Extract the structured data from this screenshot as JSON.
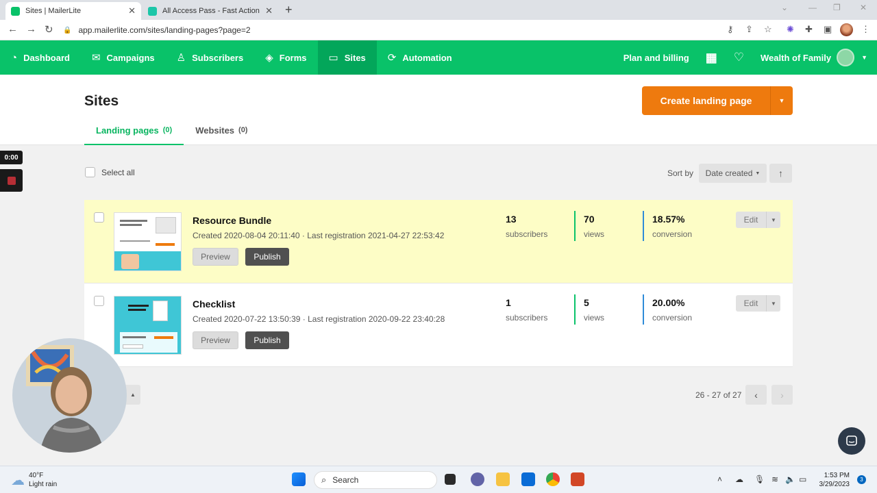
{
  "browser": {
    "tabs": [
      {
        "title": "Sites | MailerLite",
        "favicon_color": "#09c269"
      },
      {
        "title": "All Access Pass - Fast Action » Po",
        "favicon_color": "#1cc6a8"
      }
    ],
    "url": "app.mailerlite.com/sites/landing-pages?page=2"
  },
  "appnav": {
    "items": [
      {
        "label": "Dashboard",
        "icon": "dashboard-icon"
      },
      {
        "label": "Campaigns",
        "icon": "envelope-icon"
      },
      {
        "label": "Subscribers",
        "icon": "person-icon"
      },
      {
        "label": "Forms",
        "icon": "layers-icon"
      },
      {
        "label": "Sites",
        "icon": "browser-icon"
      },
      {
        "label": "Automation",
        "icon": "refresh-icon"
      }
    ],
    "plan_billing": "Plan and billing",
    "account_name": "Wealth of Family"
  },
  "page": {
    "title": "Sites",
    "tabs": [
      {
        "label": "Landing pages",
        "count": "(0)"
      },
      {
        "label": "Websites",
        "count": "(0)"
      }
    ],
    "create_button": "Create landing page",
    "select_all": "Select all",
    "sort_label": "Sort by",
    "sort_value": "Date created"
  },
  "landing_pages": [
    {
      "name": "Resource Bundle",
      "meta": "Created 2020-08-04 20:11:40 · Last registration 2021-04-27 22:53:42",
      "subscribers": "13",
      "subscribers_label": "subscribers",
      "views": "70",
      "views_label": "views",
      "conversion": "18.57%",
      "conversion_label": "conversion",
      "preview": "Preview",
      "publish": "Publish",
      "edit": "Edit"
    },
    {
      "name": "Checklist",
      "meta": "Created 2020-07-22 13:50:39 · Last registration 2020-09-22 23:40:28",
      "subscribers": "1",
      "subscribers_label": "subscribers",
      "views": "5",
      "views_label": "views",
      "conversion": "20.00%",
      "conversion_label": "conversion",
      "preview": "Preview",
      "publish": "Publish",
      "edit": "Edit"
    }
  ],
  "pager": {
    "info": "26 - 27 of 27"
  },
  "recorder": {
    "time": "0:00"
  },
  "taskbar": {
    "temp": "40°F",
    "condition": "Light rain",
    "search": "Search",
    "time": "1:53 PM",
    "date": "3/29/2023",
    "notifications": "3"
  },
  "colors": {
    "brand": "#09c269",
    "accent": "#ee7a0e",
    "highlight": "#fdfdc6"
  }
}
